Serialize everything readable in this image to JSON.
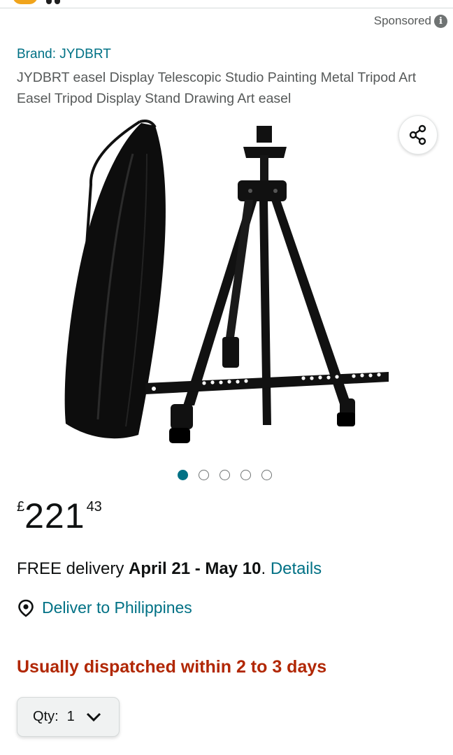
{
  "sponsored": {
    "label": "Sponsored",
    "info_icon": "info-icon"
  },
  "product": {
    "brand": "Brand: JYDBRT",
    "title": "JYDBRT easel Display Telescopic Studio Painting Metal Tripod Art Easel Tripod Display Stand Drawing Art easel",
    "share_icon": "share-icon",
    "carousel": {
      "count": 5,
      "active_index": 0
    }
  },
  "price": {
    "currency": "£",
    "whole": "221",
    "fraction": "43"
  },
  "delivery": {
    "prefix": "FREE delivery ",
    "dates": "April 21 - May 10",
    "suffix": ". ",
    "details_link": "Details"
  },
  "location": {
    "label": "Deliver to Philippines",
    "icon": "location-pin-icon"
  },
  "dispatch": {
    "text": "Usually dispatched within 2 to 3 days"
  },
  "quantity": {
    "label": "Qty:",
    "value": "1",
    "icon": "chevron-down-icon"
  },
  "colors": {
    "link": "#007185",
    "dispatch": "#b12704",
    "text": "#0f1111",
    "muted": "#565959"
  }
}
